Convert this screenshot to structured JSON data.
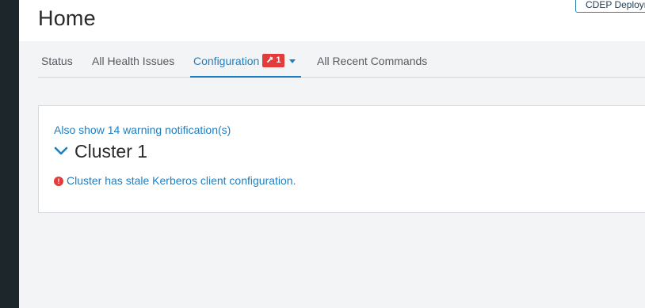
{
  "page": {
    "title": "Home"
  },
  "header": {
    "cluster_button_label": "CDEP Deployment"
  },
  "tabs": [
    {
      "label": "Status",
      "active": false
    },
    {
      "label": "All Health Issues",
      "active": false
    },
    {
      "label": "Configuration",
      "active": true,
      "badge_count": "1",
      "badge_icon": "wrench-icon"
    },
    {
      "label": "All Recent Commands",
      "active": false
    }
  ],
  "card": {
    "warnings_link": "Also show 14 warning notification(s)",
    "cluster_name": "Cluster 1",
    "issues": [
      {
        "text": "Cluster has stale Kerberos client configuration.",
        "severity": "error"
      }
    ]
  },
  "colors": {
    "accent": "#1d7fc3",
    "error": "#e23b3b",
    "sidebar": "#1d262b"
  }
}
